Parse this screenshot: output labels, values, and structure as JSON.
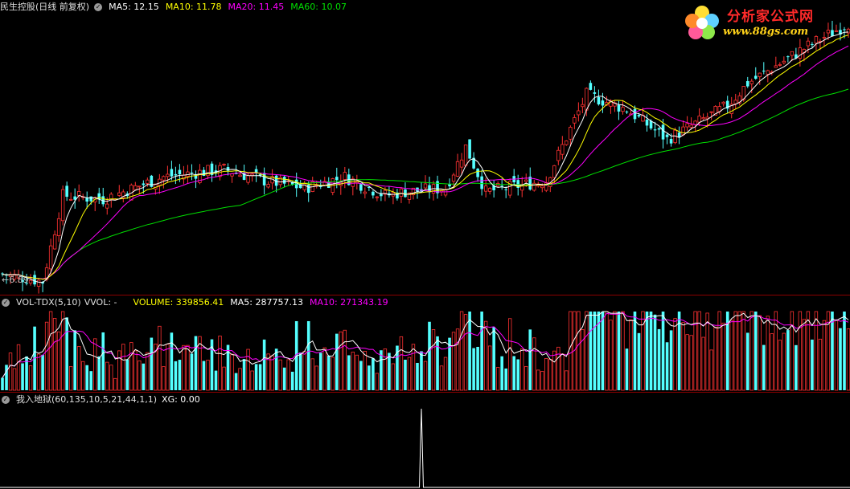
{
  "header_main": {
    "name": "民生控股(日线 前复权)",
    "ma5": "MA5: 12.15",
    "ma10": "MA10: 11.78",
    "ma20": "MA20: 11.45",
    "ma60": "MA60: 10.07"
  },
  "header_vol": {
    "name": "VOL-TDX(5,10)",
    "vvol": "VVOL: -",
    "volume": "VOLUME: 339856.41",
    "ma5": "MA5: 287757.13",
    "ma10": "MA10: 271343.19"
  },
  "header_ind": {
    "name": "我入地狱(60,135,10,5,21,44,1,1)",
    "xg": "XG: 0.00"
  },
  "logo": {
    "main": "分析家公式网",
    "sub": "www.88gs.com"
  },
  "price_low_label": "6.89",
  "colors": {
    "up": "#ff3232",
    "down": "#54ffff",
    "ma5": "#ffffff",
    "ma10": "#ffff00",
    "ma20": "#ff00ff",
    "ma60": "#00e000",
    "separator": "#8b0000"
  },
  "chart_data": [
    {
      "type": "candlestick",
      "series": "price",
      "anchors": [
        [
          0,
          7.2
        ],
        [
          10,
          7.0
        ],
        [
          15,
          9.3
        ],
        [
          25,
          9.2
        ],
        [
          40,
          9.8
        ],
        [
          55,
          10.0
        ],
        [
          65,
          9.7
        ],
        [
          75,
          9.5
        ],
        [
          85,
          9.8
        ],
        [
          95,
          9.3
        ],
        [
          100,
          9.4
        ],
        [
          110,
          9.5
        ],
        [
          115,
          10.6
        ],
        [
          120,
          9.4
        ],
        [
          135,
          9.7
        ],
        [
          145,
          12.0
        ],
        [
          155,
          11.6
        ],
        [
          165,
          10.8
        ],
        [
          180,
          11.7
        ],
        [
          185,
          12.3
        ],
        [
          200,
          13.3
        ],
        [
          210,
          13.9
        ]
      ],
      "ma_labels": [
        "MA5",
        "MA10",
        "MA20",
        "MA60"
      ],
      "min_label": 6.89
    },
    {
      "type": "bar",
      "series": "volume",
      "ma_labels": [
        "MA5",
        "MA10"
      ],
      "last_volume": 339856.41,
      "last_ma5": 287757.13,
      "last_ma10": 271343.19
    },
    {
      "type": "line",
      "series": "XG",
      "last_value": 0.0
    }
  ]
}
